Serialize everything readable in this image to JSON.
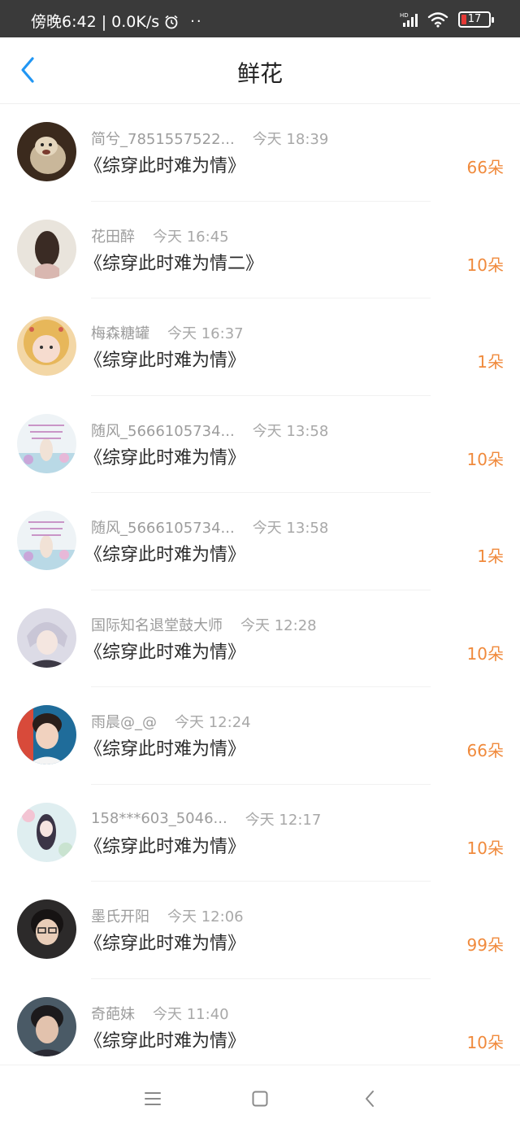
{
  "status_bar": {
    "time_text": "傍晚6:42 | 0.0K/s",
    "dots": "··",
    "battery_level": "17",
    "icons": [
      "alarm-icon",
      "signal-icon",
      "wifi-icon",
      "battery-icon"
    ]
  },
  "nav": {
    "title": "鲜花",
    "back_icon": "chevron-left-icon",
    "accent_color": "#2196f3"
  },
  "items": [
    {
      "name": "简兮_7851557522...",
      "time": "今天 18:39",
      "book": "《综穿此时难为情》",
      "count": "66朵"
    },
    {
      "name": "花田醉",
      "time": "今天 16:45",
      "book": "《综穿此时难为情二》",
      "count": "10朵"
    },
    {
      "name": "梅森糖罐",
      "time": "今天 16:37",
      "book": "《综穿此时难为情》",
      "count": "1朵"
    },
    {
      "name": "随风_5666105734...",
      "time": "今天 13:58",
      "book": "《综穿此时难为情》",
      "count": "10朵"
    },
    {
      "name": "随风_5666105734...",
      "time": "今天 13:58",
      "book": "《综穿此时难为情》",
      "count": "1朵"
    },
    {
      "name": "国际知名退堂鼓大师",
      "time": "今天 12:28",
      "book": "《综穿此时难为情》",
      "count": "10朵"
    },
    {
      "name": "雨晨@_@",
      "time": "今天 12:24",
      "book": "《综穿此时难为情》",
      "count": "66朵"
    },
    {
      "name": "158***603_5046...",
      "time": "今天 12:17",
      "book": "《综穿此时难为情》",
      "count": "10朵"
    },
    {
      "name": "墨氏开阳",
      "time": "今天 12:06",
      "book": "《综穿此时难为情》",
      "count": "99朵"
    },
    {
      "name": "奇葩妹",
      "time": "今天 11:40",
      "book": "《综穿此时难为情》",
      "count": "10朵"
    }
  ],
  "bottom_nav": {
    "icons": [
      "menu-icon",
      "home-square-icon",
      "back-chevron-icon"
    ]
  },
  "colors": {
    "count": "#f08a3c",
    "status_bar_bg": "#3a3a3a"
  }
}
